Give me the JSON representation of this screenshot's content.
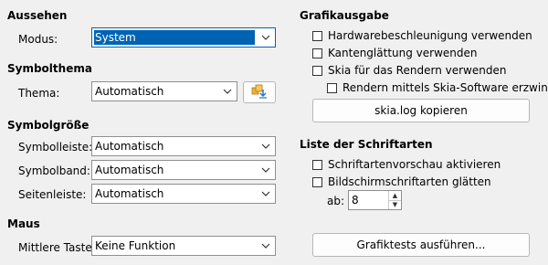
{
  "left": {
    "appearance": {
      "heading": "Aussehen",
      "mode_label": "Modus:",
      "mode_value": "System"
    },
    "icon_theme": {
      "heading": "Symbolthema",
      "theme_label": "Thema:",
      "theme_value": "Automatisch"
    },
    "icon_size": {
      "heading": "Symbolgröße",
      "toolbar_label": "Symbolleiste:",
      "toolbar_value": "Automatisch",
      "notebookbar_label": "Symbolband:",
      "notebookbar_value": "Automatisch",
      "sidebar_label": "Seitenleiste:",
      "sidebar_value": "Automatisch"
    },
    "mouse": {
      "heading": "Maus",
      "middle_label": "Mittlere Taste:",
      "middle_value": "Keine Funktion"
    }
  },
  "right": {
    "graphics": {
      "heading": "Grafikausgabe",
      "hw_accel": "Hardwarebeschleunigung verwenden",
      "antialias": "Kantenglättung verwenden",
      "skia": "Skia für das Rendern verwenden",
      "skia_software": "Rendern mittels Skia-Software erzwingen",
      "copy_log": "skia.log kopieren"
    },
    "fonts": {
      "heading": "Liste der Schriftarten",
      "preview": "Schriftartenvorschau aktivieren",
      "smooth": "Bildschirmschriftarten glätten",
      "from_label": "ab:",
      "from_value": "8",
      "run_tests": "Grafiktests ausführen..."
    }
  },
  "icons": {
    "dropdown": "chevron-down-icon",
    "add_theme": "add-extension-icon"
  },
  "colors": {
    "selection": "#0063b1",
    "background": "#f0f0f0"
  }
}
